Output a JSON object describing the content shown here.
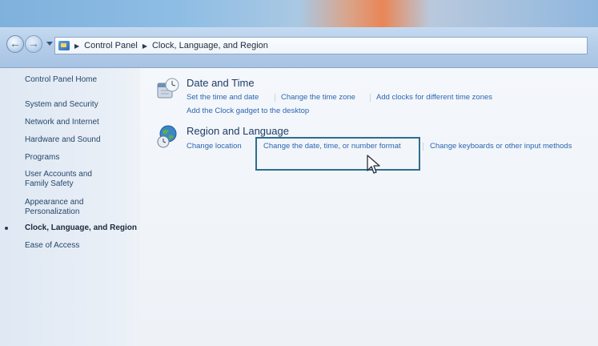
{
  "breadcrumb": {
    "items": [
      "Control Panel",
      "Clock, Language, and Region"
    ]
  },
  "sidebar": {
    "items": [
      {
        "label": "Control Panel Home"
      },
      {
        "label": "System and Security"
      },
      {
        "label": "Network and Internet"
      },
      {
        "label": "Hardware and Sound"
      },
      {
        "label": "Programs"
      },
      {
        "label": "User Accounts and Family Safety"
      },
      {
        "label": "Appearance and Personalization"
      },
      {
        "label": "Clock, Language, and Region",
        "active": true
      },
      {
        "label": "Ease of Access"
      }
    ]
  },
  "categories": [
    {
      "title": "Date and Time",
      "icon": "clock-calendar-icon",
      "links": [
        "Set the time and date",
        "Change the time zone",
        "Add clocks for different time zones"
      ],
      "links2": [
        "Add the Clock gadget to the desktop"
      ]
    },
    {
      "title": "Region and Language",
      "icon": "globe-clock-icon",
      "links": [
        "Change location",
        "Change the date, time, or number format",
        "Change keyboards or other input methods"
      ]
    }
  ],
  "colors": {
    "link": "#2d66b1",
    "title": "#1e3d66",
    "highlight": "#2e6d8f"
  }
}
